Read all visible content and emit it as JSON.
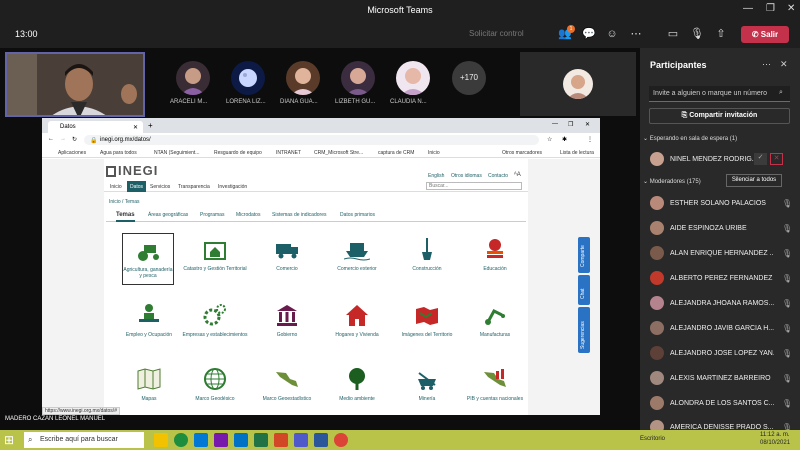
{
  "teams": {
    "title": "Microsoft Teams",
    "clock": "13:00",
    "request_control": "Solicitar control",
    "leave_label": "Salir",
    "people_badge": "1"
  },
  "stage": {
    "participants": [
      {
        "name": "ARACELI M..."
      },
      {
        "name": "LORENA LIZ..."
      },
      {
        "name": "DIANA GUA..."
      },
      {
        "name": "LIZBETH GU..."
      },
      {
        "name": "CLAUDIA N..."
      }
    ],
    "more_count": "+170",
    "presenter_label": "MADERO CAZAN LEONEL MANUEL"
  },
  "browser": {
    "tab_title": "Datos",
    "new_tab": "+",
    "url": "inegi.org.mx/datos/",
    "bookmarks": [
      "Aplicaciones",
      "Agua para todos",
      "NTAN (Seguimient...",
      "Resguardo de equipo",
      "INTRANET",
      "CRM_Microsoft Stre...",
      "captura de CRM",
      "Inicio"
    ],
    "bookmarks_right": [
      "Otros marcadores",
      "Lista de lectura"
    ],
    "status_url": "https://www.inegi.org.mx/datos/#"
  },
  "site": {
    "logo": "INEGI",
    "top_links": [
      "English",
      "Otros idiomas",
      "Contacto"
    ],
    "nav": [
      "Inicio",
      "Datos",
      "Servicios",
      "Transparencia",
      "Investigación"
    ],
    "search_placeholder": "Buscar...",
    "breadcrumb": "Inicio / Temas",
    "tabs": [
      "Temas",
      "Áreas geográficas",
      "Programas",
      "Microdatos",
      "Sistemas de indicadores",
      "Datos primarios"
    ],
    "categories": [
      "Agricultura, ganadería y pesca",
      "Catastro y Gestión Territorial",
      "Comercio",
      "Comercio exterior",
      "Construcción",
      "Educación",
      "Empleo y Ocupación",
      "Empresas y establecimientos",
      "Gobierno",
      "Hogares y Vivienda",
      "Imágenes del Territorio",
      "Manufacturas",
      "Mapas",
      "Marco Geodésico",
      "Marco Geoestadístico",
      "Medio ambiente",
      "Minería",
      "PIB y cuentas nacionales"
    ],
    "side_tabs": [
      "Comparte",
      "Chat",
      "Sugerencias"
    ]
  },
  "panel": {
    "title": "Participantes",
    "invite_placeholder": "Invite a alguien o marque un número",
    "share_invite": "Compartir invitación",
    "lobby_header": "Esperando en sala de espera (1)",
    "lobby_person": "NINEL MENDEZ RODRIG...",
    "moderators_header": "Moderadores (175)",
    "mute_all": "Silenciar a todos",
    "people": [
      "ESTHER SOLANO PALACIOS",
      "AIDE ESPINOZA URIBE",
      "ALAN ENRIQUE HERNANDEZ ...",
      "ALBERTO PEREZ FERNANDEZ",
      "ALEJANDRA JHOANA RAMOS...",
      "ALEJANDRO JAVIB GARCIA H...",
      "ALEJANDRO JOSE LOPEZ YAÑ...",
      "ALEXIS MARTINEZ BARREIRO",
      "ALONDRA DE LOS SANTOS C...",
      "AMERICA DENISSE PRADO S..."
    ]
  },
  "taskbar": {
    "search_placeholder": "Escribe aquí para buscar",
    "time": "11:12 a. m.",
    "date": "08/10/2021",
    "tray_label": "Escritorio"
  },
  "colors": {
    "teams_purple": "#6264a7",
    "leave_red": "#c4314b",
    "inegi_teal": "#1d5f66",
    "taskbar": "#b9c34a"
  }
}
